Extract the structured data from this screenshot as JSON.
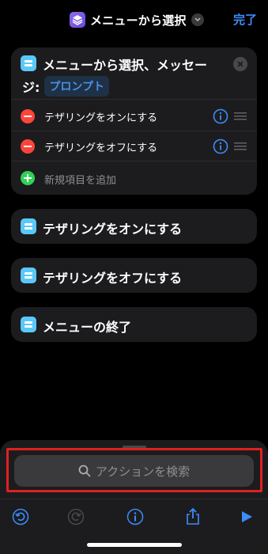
{
  "header": {
    "title": "メニューから選択",
    "done_label": "完了"
  },
  "menu_action": {
    "title_line1": "メニューから選択、メッセー",
    "title_line2": "ジ:",
    "prompt_token": "プロンプト",
    "options": [
      {
        "label": "テザリングをオンにする"
      },
      {
        "label": "テザリングをオフにする"
      }
    ],
    "add_label": "新規項目を追加"
  },
  "blocks": [
    {
      "label": "テザリングをオンにする"
    },
    {
      "label": "テザリングをオフにする"
    },
    {
      "label": "メニューの終了"
    }
  ],
  "search": {
    "placeholder": "アクションを検索"
  },
  "toolbar": {
    "buttons": [
      "undo-icon",
      "redo-icon",
      "info-icon",
      "share-icon",
      "play-icon"
    ]
  },
  "colors": {
    "accent": "#3d8bfd",
    "remove": "#ff453a",
    "add": "#30d158",
    "highlight": "#e02020",
    "action_icon": "#5ac8fa"
  }
}
